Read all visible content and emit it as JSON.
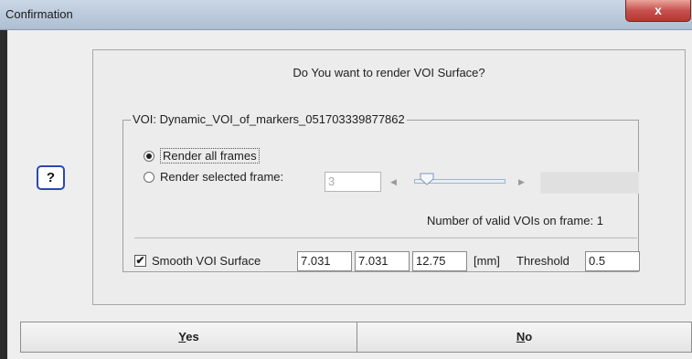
{
  "window": {
    "title": "Confirmation",
    "close_label": "x"
  },
  "icon": {
    "glyph": "?"
  },
  "dialog": {
    "question": "Do You want to render VOI Surface?",
    "group_title": "VOI: Dynamic_VOI_of_markers_051703339877862",
    "render_all_label": "Render all frames",
    "render_selected_label": "Render selected frame:",
    "selected_frame_value": "3",
    "valid_vois_label": "Number of valid VOIs on frame:",
    "valid_vois_count": "1",
    "smooth_label": "Smooth VOI Surface",
    "smooth_checked": true,
    "smooth_values": [
      "7.031",
      "7.031",
      "12.75"
    ],
    "unit_label": "[mm]",
    "threshold_label": "Threshold",
    "threshold_value": "0.5"
  },
  "buttons": {
    "yes_mnemonic": "Y",
    "yes_rest": "es",
    "no_mnemonic": "N",
    "no_rest": "o"
  }
}
